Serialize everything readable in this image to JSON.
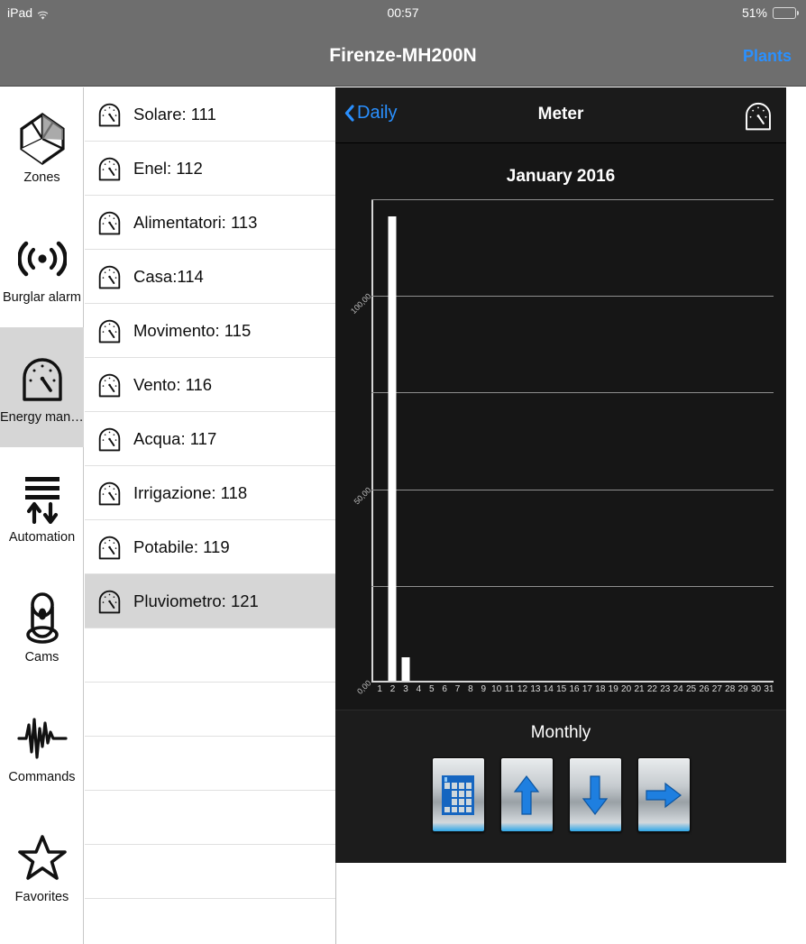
{
  "statusbar": {
    "device": "iPad",
    "wifi_icon": "wifi-icon",
    "time": "00:57",
    "battery_percent": "51%",
    "battery_level": 51
  },
  "navbar": {
    "title": "Firenze-MH200N",
    "right_button": "Plants",
    "accent_color": "#2a90ff",
    "background": "#6e6e6e"
  },
  "sidebar": {
    "items": [
      {
        "label": "Zones",
        "icon": "zones-icon",
        "selected": false
      },
      {
        "label": "Burglar alarm",
        "icon": "burglar-alarm-icon",
        "selected": false
      },
      {
        "label": "Energy mana...",
        "icon": "energy-meter-icon",
        "selected": true
      },
      {
        "label": "Automation",
        "icon": "automation-icon",
        "selected": false
      },
      {
        "label": "Cams",
        "icon": "cams-icon",
        "selected": false
      },
      {
        "label": "Commands",
        "icon": "commands-icon",
        "selected": false
      },
      {
        "label": "Favorites",
        "icon": "favorites-star-icon",
        "selected": false
      }
    ]
  },
  "meter_list": {
    "items": [
      {
        "label": "Solare: 111",
        "icon": "meter-icon",
        "selected": false
      },
      {
        "label": "Enel: 112",
        "icon": "meter-icon",
        "selected": false
      },
      {
        "label": "Alimentatori: 113",
        "icon": "meter-icon",
        "selected": false
      },
      {
        "label": "Casa:114",
        "icon": "meter-icon",
        "selected": false
      },
      {
        "label": "Movimento: 115",
        "icon": "meter-icon",
        "selected": false
      },
      {
        "label": "Vento: 116",
        "icon": "meter-icon",
        "selected": false
      },
      {
        "label": "Acqua: 117",
        "icon": "meter-icon",
        "selected": false
      },
      {
        "label": "Irrigazione: 118",
        "icon": "meter-icon",
        "selected": false
      },
      {
        "label": "Potabile: 119",
        "icon": "meter-icon",
        "selected": false
      },
      {
        "label": "Pluviometro: 121",
        "icon": "meter-icon",
        "selected": true
      }
    ],
    "empty_rows": 5
  },
  "detail": {
    "back_label": "Daily",
    "back_icon": "chevron-left-icon",
    "title": "Meter",
    "right_icon": "meter-icon",
    "footer_label": "Monthly",
    "footer_buttons": [
      {
        "icon": "calendar-grid-icon",
        "name": "calendar-button"
      },
      {
        "icon": "arrow-up-icon",
        "name": "previous-button"
      },
      {
        "icon": "arrow-down-icon",
        "name": "next-button"
      },
      {
        "icon": "arrow-right-icon",
        "name": "forward-button"
      }
    ]
  },
  "chart_data": {
    "type": "bar",
    "title": "January 2016",
    "xlabel": "",
    "ylabel": "",
    "ylim": [
      0,
      125
    ],
    "grid": true,
    "legend": false,
    "y_ticks": [
      0,
      25,
      50,
      75,
      100,
      125
    ],
    "y_tick_labels": [
      "0,00",
      "",
      "50,00",
      "",
      "100,00",
      ""
    ],
    "categories": [
      "1",
      "2",
      "3",
      "4",
      "5",
      "6",
      "7",
      "8",
      "9",
      "10",
      "11",
      "12",
      "13",
      "14",
      "15",
      "16",
      "17",
      "18",
      "19",
      "20",
      "21",
      "22",
      "23",
      "24",
      "25",
      "26",
      "27",
      "28",
      "29",
      "30",
      "31"
    ],
    "values": [
      0,
      120,
      6,
      0,
      0,
      0,
      0,
      0,
      0,
      0,
      0,
      0,
      0,
      0,
      0,
      0,
      0,
      0,
      0,
      0,
      0,
      0,
      0,
      0,
      0,
      0,
      0,
      0,
      0,
      0,
      0
    ],
    "bar_color": "#ffffff",
    "background": "#1f1f1f"
  }
}
